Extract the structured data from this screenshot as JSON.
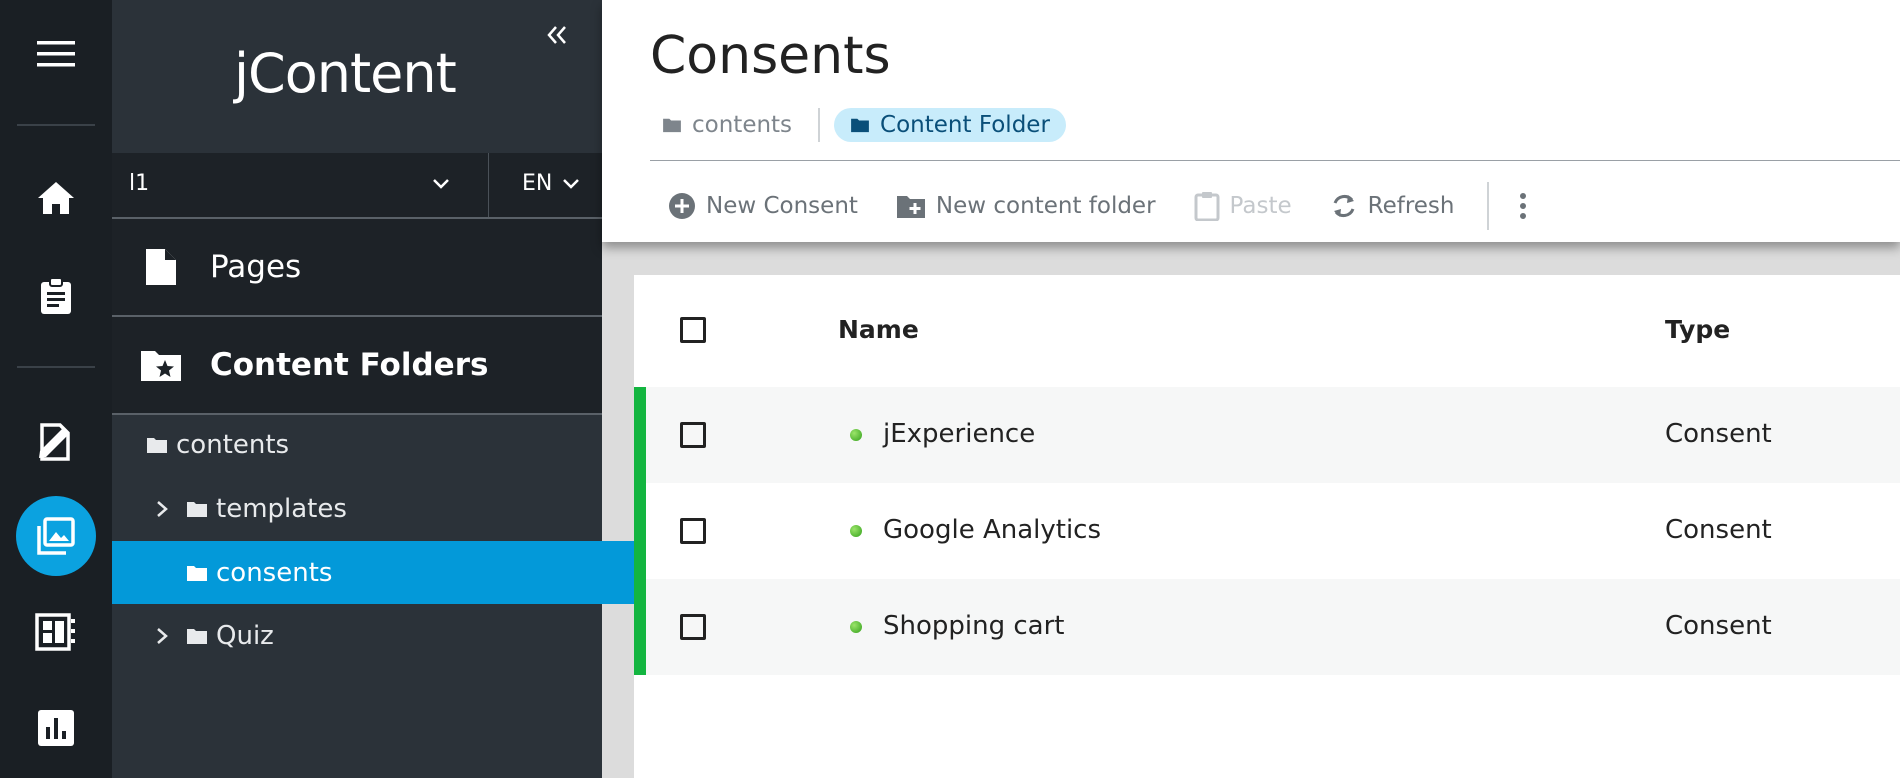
{
  "app": {
    "logo": "jContent"
  },
  "nav": {
    "site": "l1",
    "language": "EN",
    "pages_label": "Pages",
    "content_folders_label": "Content Folders",
    "tree": [
      {
        "label": "contents"
      },
      {
        "label": "templates"
      },
      {
        "label": "consents"
      },
      {
        "label": "Quiz"
      }
    ]
  },
  "header": {
    "title": "Consents",
    "breadcrumb": {
      "root": "contents",
      "current": "Content Folder"
    }
  },
  "toolbar": {
    "new_consent": "New Consent",
    "new_folder": "New content folder",
    "paste": "Paste",
    "refresh": "Refresh"
  },
  "table": {
    "columns": {
      "name": "Name",
      "type": "Type"
    },
    "rows": [
      {
        "name": "jExperience",
        "type": "Consent"
      },
      {
        "name": "Google Analytics",
        "type": "Consent"
      },
      {
        "name": "Shopping cart",
        "type": "Consent"
      }
    ]
  },
  "colors": {
    "accent": "#0399d9",
    "rail": "#1a1f24",
    "nav": "#2b3239",
    "published": "#13b540"
  }
}
